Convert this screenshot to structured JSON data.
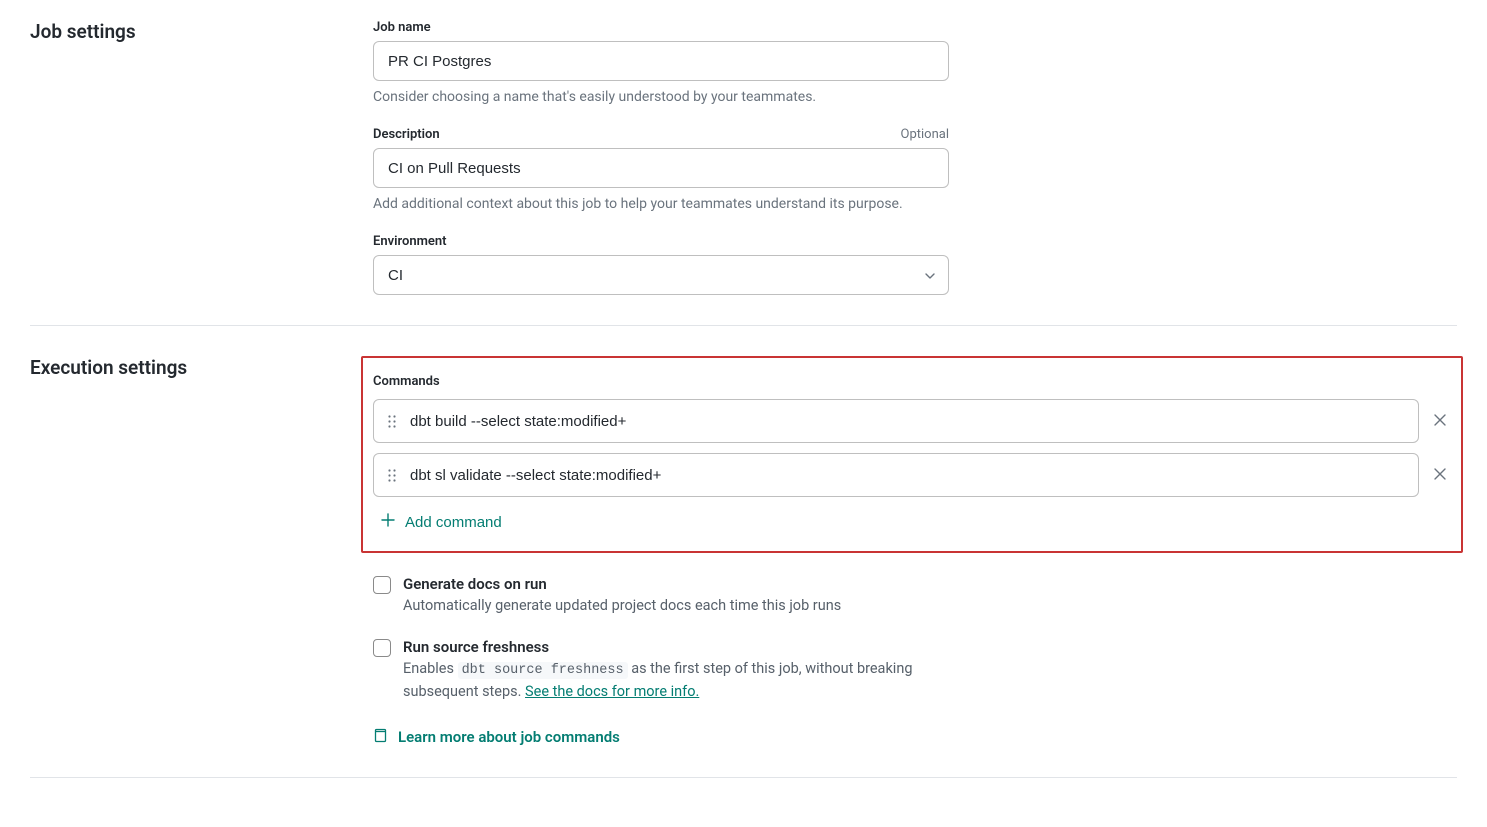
{
  "job_settings": {
    "title": "Job settings",
    "job_name": {
      "label": "Job name",
      "value": "PR CI Postgres",
      "help": "Consider choosing a name that's easily understood by your teammates."
    },
    "description": {
      "label": "Description",
      "optional": "Optional",
      "value": "CI on Pull Requests",
      "help": "Add additional context about this job to help your teammates understand its purpose."
    },
    "environment": {
      "label": "Environment",
      "value": "CI"
    }
  },
  "execution_settings": {
    "title": "Execution settings",
    "commands_label": "Commands",
    "commands": [
      "dbt build --select state:modified+",
      "dbt sl validate --select state:modified+"
    ],
    "add_command": "Add command",
    "generate_docs": {
      "label": "Generate docs on run",
      "desc": "Automatically generate updated project docs each time this job runs"
    },
    "source_freshness": {
      "label": "Run source freshness",
      "desc_prefix": "Enables ",
      "desc_code": "dbt source freshness",
      "desc_suffix": " as the first step of this job, without breaking subsequent steps. ",
      "link": "See the docs for more info."
    },
    "learn_more": "Learn more about job commands"
  }
}
